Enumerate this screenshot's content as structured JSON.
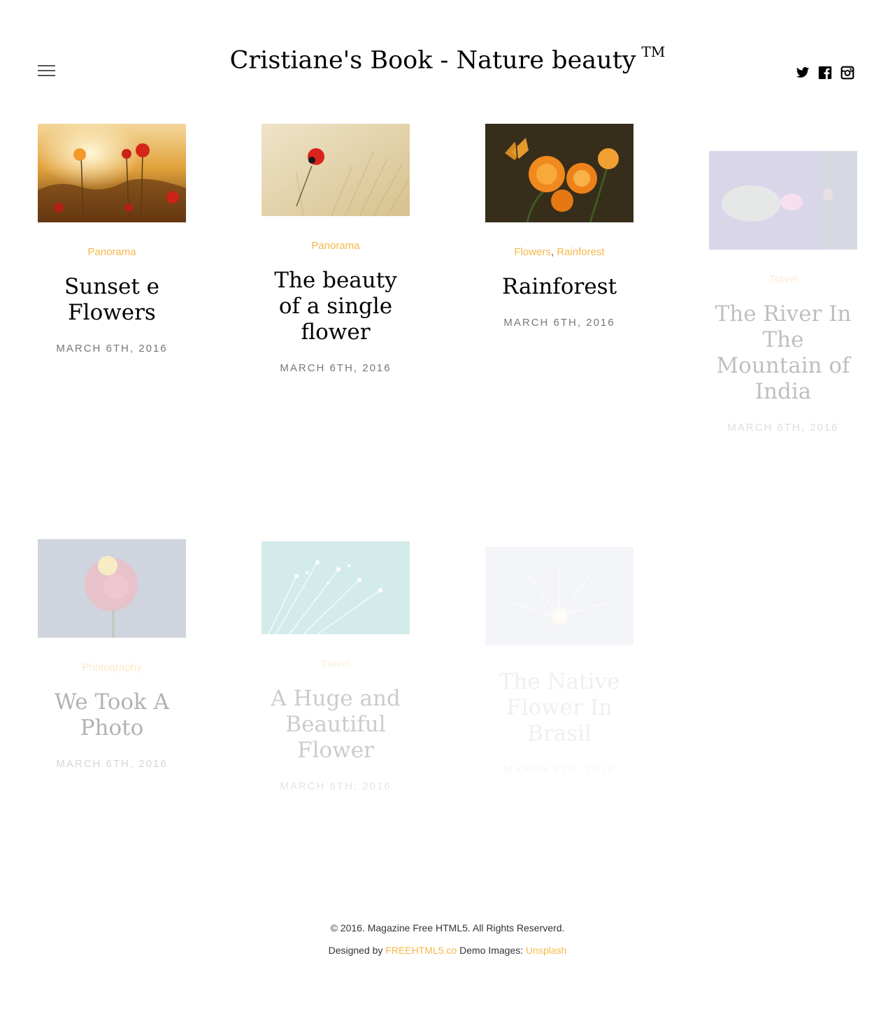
{
  "header": {
    "title": "Cristiane's Book - Nature beauty",
    "trademark": "TM"
  },
  "social": [
    "twitter-icon",
    "facebook-icon",
    "instagram-icon"
  ],
  "posts": [
    {
      "categories": [
        "Panorama"
      ],
      "title": "Sunset e Flowers",
      "date": "MARCH 6TH, 2016"
    },
    {
      "categories": [
        "Panorama"
      ],
      "title": "The beauty of a single flower",
      "date": "MARCH 6TH, 2016"
    },
    {
      "categories": [
        "Flowers",
        "Rainforest"
      ],
      "title": "Rainforest",
      "date": "MARCH 6TH, 2016"
    },
    {
      "categories": [
        "Travel"
      ],
      "title": "The River In The Mountain of India",
      "date": "MARCH 6TH, 2016"
    },
    {
      "categories": [
        "Photography"
      ],
      "title": "We Took A Photo",
      "date": "MARCH 6TH, 2016"
    },
    {
      "categories": [
        "Travel"
      ],
      "title": "A Huge and Beautiful Flower",
      "date": "MARCH 6TH, 2016"
    },
    {
      "categories": [],
      "title": "The Native Flower In Brasil",
      "date": "MARCH 6TH, 2016"
    }
  ],
  "footer": {
    "copyright": "© 2016. Magazine Free HTML5. All Rights Reserverd.",
    "designed_by_label": "Designed by",
    "designer": "FREEHTML5.co",
    "demo_images_label": "Demo Images:",
    "images_source": "Unsplash"
  },
  "colors": {
    "accent": "#f5b74a",
    "text": "#000000",
    "muted": "#777777"
  }
}
